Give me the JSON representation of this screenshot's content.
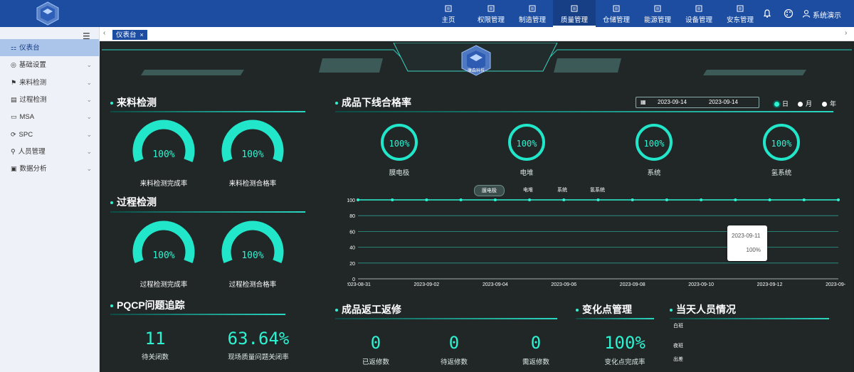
{
  "app": {
    "logo_text": "康森科技",
    "user_name": "系统演示"
  },
  "nav": [
    {
      "label": "主页",
      "icon": "home-icon"
    },
    {
      "label": "权限管理",
      "icon": "document-icon"
    },
    {
      "label": "制造管理",
      "icon": "grid-icon"
    },
    {
      "label": "质量管理",
      "icon": "document-icon",
      "active": true
    },
    {
      "label": "仓储管理",
      "icon": "warehouse-icon"
    },
    {
      "label": "能源管理",
      "icon": "document-icon"
    },
    {
      "label": "设备管理",
      "icon": "document-icon"
    },
    {
      "label": "安东管理",
      "icon": "alarm-icon"
    }
  ],
  "sidebar": {
    "items": [
      {
        "label": "仪表台",
        "active": true
      },
      {
        "label": "基础设置"
      },
      {
        "label": "来料检测"
      },
      {
        "label": "过程检测"
      },
      {
        "label": "MSA"
      },
      {
        "label": "SPC"
      },
      {
        "label": "人员管理"
      },
      {
        "label": "数据分析"
      }
    ]
  },
  "tabs": {
    "active_label": "仪表台",
    "close_glyph": "×"
  },
  "dashboard": {
    "incoming": {
      "title": "来料检测",
      "gauges": [
        {
          "value": "100%",
          "label": "来料检测完成率",
          "fraction": 1.0
        },
        {
          "value": "100%",
          "label": "来料检测合格率",
          "fraction": 1.0
        }
      ]
    },
    "process": {
      "title": "过程检测",
      "gauges": [
        {
          "value": "100%",
          "label": "过程检测完成率",
          "fraction": 1.0
        },
        {
          "value": "100%",
          "label": "过程检测合格率",
          "fraction": 1.0
        }
      ]
    },
    "pqcp": {
      "title": "PQCP问题追踪",
      "stats": [
        {
          "value": "11",
          "label": "待关闭数"
        },
        {
          "value": "63.64%",
          "label": "现场质量问题关闭率"
        }
      ]
    },
    "yield": {
      "title": "成品下线合格率",
      "date_start": "2023-09-14",
      "date_end": "2023-09-14",
      "radios": [
        {
          "label": "日",
          "on": true
        },
        {
          "label": "月",
          "on": false
        },
        {
          "label": "年",
          "on": false
        }
      ],
      "circles": [
        {
          "value": "100%",
          "label": "膜电极"
        },
        {
          "value": "100%",
          "label": "电堆"
        },
        {
          "value": "100%",
          "label": "系统"
        },
        {
          "value": "100%",
          "label": "氢系统"
        }
      ],
      "legend": [
        {
          "label": "膜电极",
          "on": true
        },
        {
          "label": "电堆"
        },
        {
          "label": "系统"
        },
        {
          "label": "氢系统"
        }
      ],
      "tooltip": {
        "date": "2023-09-11",
        "value": "100%"
      }
    },
    "rework": {
      "title": "成品返工返修",
      "stats": [
        {
          "value": "0",
          "label": "已返修数"
        },
        {
          "value": "0",
          "label": "待返修数"
        },
        {
          "value": "0",
          "label": "需返修数"
        }
      ]
    },
    "change": {
      "title": "变化点管理",
      "stats": [
        {
          "value": "100%",
          "label": "变化点完成率"
        }
      ]
    },
    "staff": {
      "title": "当天人员情况",
      "rows": [
        "白班",
        "夜班",
        "出差"
      ]
    }
  },
  "chart_data": {
    "type": "line",
    "x": [
      "2023-08-31",
      "2023-09-01",
      "2023-09-02",
      "2023-09-03",
      "2023-09-04",
      "2023-09-05",
      "2023-09-06",
      "2023-09-07",
      "2023-09-08",
      "2023-09-09",
      "2023-09-10",
      "2023-09-11",
      "2023-09-12",
      "2023-09-13",
      "2023-09-14"
    ],
    "x_tick_labels": [
      "2023-08-31",
      "2023-09-02",
      "2023-09-04",
      "2023-09-06",
      "2023-09-08",
      "2023-09-10",
      "2023-09-12",
      "2023-09-14"
    ],
    "series": [
      {
        "name": "膜电极",
        "values": [
          100,
          100,
          100,
          100,
          100,
          100,
          100,
          100,
          100,
          100,
          100,
          100,
          100,
          100,
          100
        ]
      }
    ],
    "ylim": [
      0,
      100
    ],
    "yticks": [
      0,
      20,
      40,
      60,
      80,
      100
    ],
    "grid": true,
    "legend": "top-center",
    "color": "#2ef3d2"
  }
}
